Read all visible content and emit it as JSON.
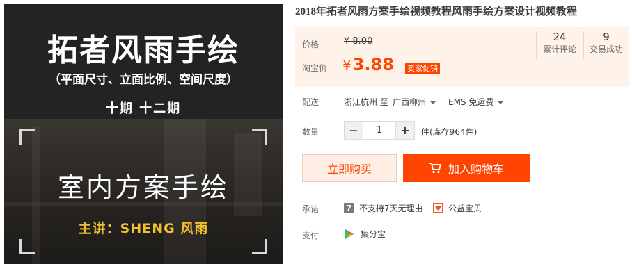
{
  "image": {
    "title": "拓者风雨手绘",
    "subtitle": "（平面尺寸、立面比例、空间尺度）",
    "period": "十期 十二期",
    "main_text": "室内方案手绘",
    "lecturer": "主讲：SHENG 风雨"
  },
  "product_title": "2018年拓者风雨方案手绘视频教程风雨手绘方案设计视频教程",
  "price": {
    "price_label": "价格",
    "original_price": "¥ 8.00",
    "promo_label": "淘宝价",
    "promo_currency": "¥",
    "promo_value": "3.88",
    "promo_badge": "卖家促销"
  },
  "stats": [
    {
      "value": "24",
      "caption": "累计评论"
    },
    {
      "value": "9",
      "caption": "交易成功"
    }
  ],
  "shipping": {
    "label": "配送",
    "from": "浙江杭州 至",
    "to": "广西柳州",
    "method": "EMS 免运费"
  },
  "quantity": {
    "label": "数量",
    "minus": "−",
    "value": "1",
    "plus": "+",
    "stock": "件(库存964件)"
  },
  "buttons": {
    "buy_now": "立即购买",
    "add_to_cart": "加入购物车"
  },
  "promise": {
    "label": "承诺",
    "items": [
      {
        "icon": "seven-days-icon",
        "glyph": "7",
        "text": "不支持7天无理由"
      },
      {
        "icon": "charity-gift-icon",
        "text": "公益宝贝"
      }
    ]
  },
  "payment": {
    "label": "支付",
    "method": "集分宝"
  },
  "colors": {
    "accent": "#ff4400",
    "price_bg": "#fff2e8",
    "buy_now_bg": "#ffeee3"
  }
}
